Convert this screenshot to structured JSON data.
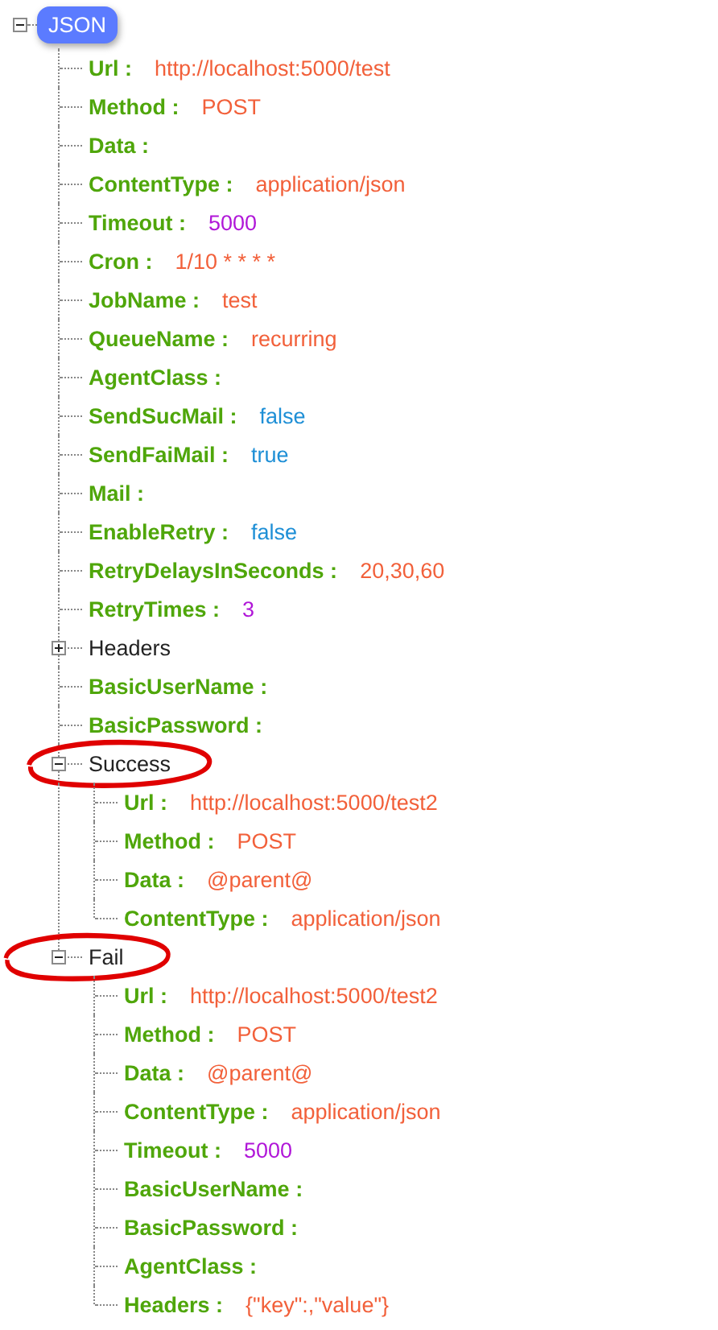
{
  "root": {
    "label": "JSON",
    "expanded": true,
    "children": [
      {
        "kind": "field",
        "key": "Url :",
        "value": "http://localhost:5000/test",
        "color": "#f2603a"
      },
      {
        "kind": "field",
        "key": "Method :",
        "value": "POST",
        "color": "#f2603a"
      },
      {
        "kind": "field",
        "key": "Data :"
      },
      {
        "kind": "field",
        "key": "ContentType :",
        "value": "application/json",
        "color": "#f2603a"
      },
      {
        "kind": "field",
        "key": "Timeout :",
        "value": "5000",
        "color": "#b016d8"
      },
      {
        "kind": "field",
        "key": "Cron :",
        "value": "1/10 * * * *",
        "color": "#f2603a"
      },
      {
        "kind": "field",
        "key": "JobName :",
        "value": "test",
        "color": "#f2603a"
      },
      {
        "kind": "field",
        "key": "QueueName :",
        "value": "recurring",
        "color": "#f2603a"
      },
      {
        "kind": "field",
        "key": "AgentClass :"
      },
      {
        "kind": "field",
        "key": "SendSucMail :",
        "value": "false",
        "color": "#1e8fd6"
      },
      {
        "kind": "field",
        "key": "SendFaiMail :",
        "value": "true",
        "color": "#1e8fd6"
      },
      {
        "kind": "field",
        "key": "Mail :"
      },
      {
        "kind": "field",
        "key": "EnableRetry :",
        "value": "false",
        "color": "#1e8fd6"
      },
      {
        "kind": "field",
        "key": "RetryDelaysInSeconds :",
        "value": "20,30,60",
        "color": "#f2603a"
      },
      {
        "kind": "field",
        "key": "RetryTimes :",
        "value": "3",
        "color": "#b016d8"
      },
      {
        "kind": "group",
        "label": "Headers",
        "expanded": false,
        "circled": false
      },
      {
        "kind": "field",
        "key": "BasicUserName :"
      },
      {
        "kind": "field",
        "key": "BasicPassword :"
      },
      {
        "kind": "group",
        "label": "Success",
        "expanded": true,
        "circled": true,
        "children": [
          {
            "kind": "field",
            "key": "Url :",
            "value": "http://localhost:5000/test2",
            "color": "#f2603a"
          },
          {
            "kind": "field",
            "key": "Method :",
            "value": "POST",
            "color": "#f2603a"
          },
          {
            "kind": "field",
            "key": "Data :",
            "value": "@parent@",
            "color": "#f2603a"
          },
          {
            "kind": "field",
            "key": "ContentType :",
            "value": "application/json",
            "color": "#f2603a"
          }
        ]
      },
      {
        "kind": "group",
        "label": "Fail",
        "expanded": true,
        "circled": true,
        "children": [
          {
            "kind": "field",
            "key": "Url :",
            "value": "http://localhost:5000/test2",
            "color": "#f2603a"
          },
          {
            "kind": "field",
            "key": "Method :",
            "value": "POST",
            "color": "#f2603a"
          },
          {
            "kind": "field",
            "key": "Data :",
            "value": "@parent@",
            "color": "#f2603a"
          },
          {
            "kind": "field",
            "key": "ContentType :",
            "value": "application/json",
            "color": "#f2603a"
          },
          {
            "kind": "field",
            "key": "Timeout :",
            "value": "5000",
            "color": "#b016d8"
          },
          {
            "kind": "field",
            "key": "BasicUserName :"
          },
          {
            "kind": "field",
            "key": "BasicPassword :"
          },
          {
            "kind": "field",
            "key": "AgentClass :"
          },
          {
            "kind": "field",
            "key": "Headers :",
            "value": "{\"key\":,\"value\"}",
            "color": "#f2603a"
          }
        ]
      }
    ]
  }
}
